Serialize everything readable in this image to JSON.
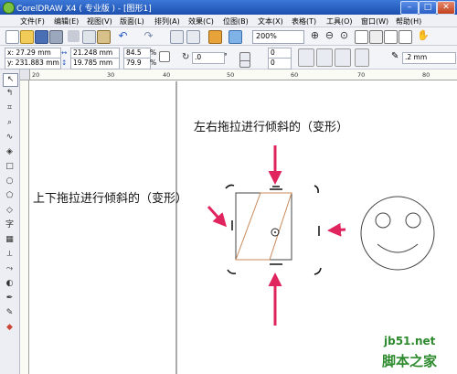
{
  "window": {
    "title": "CorelDRAW X4 ( 专业版 ) - [图形1]"
  },
  "menu": [
    "文件(F)",
    "编辑(E)",
    "视图(V)",
    "版面(L)",
    "排列(A)",
    "效果(C)",
    "位图(B)",
    "文本(X)",
    "表格(T)",
    "工具(O)",
    "窗口(W)",
    "帮助(H)"
  ],
  "toolbar": {
    "zoom": "200%"
  },
  "propbar": {
    "x": "x: 27.29 mm",
    "y": "y: 231.883 mm",
    "w": "21.248 mm",
    "h": "19.785 mm",
    "scale_w": "84.5",
    "scale_h": "79.9",
    "scale_unit": "%",
    "angle": ".0",
    "skew_h": "0",
    "skew_v": "0",
    "outline": ".2 mm"
  },
  "ruler": {
    "h_ticks": [
      "20",
      "30",
      "40",
      "50",
      "60",
      "70",
      "80"
    ],
    "v_ticks": []
  },
  "annotations": {
    "top": "左右拖拉进行倾斜的（变形）",
    "left": "上下拖拉进行倾斜的（变形）"
  },
  "watermark": {
    "line1": "jb51.net",
    "line2": "脚本之家"
  },
  "colors": {
    "arrow": "#e0245e",
    "handle": "#111111",
    "accent": "#1c4fae"
  }
}
